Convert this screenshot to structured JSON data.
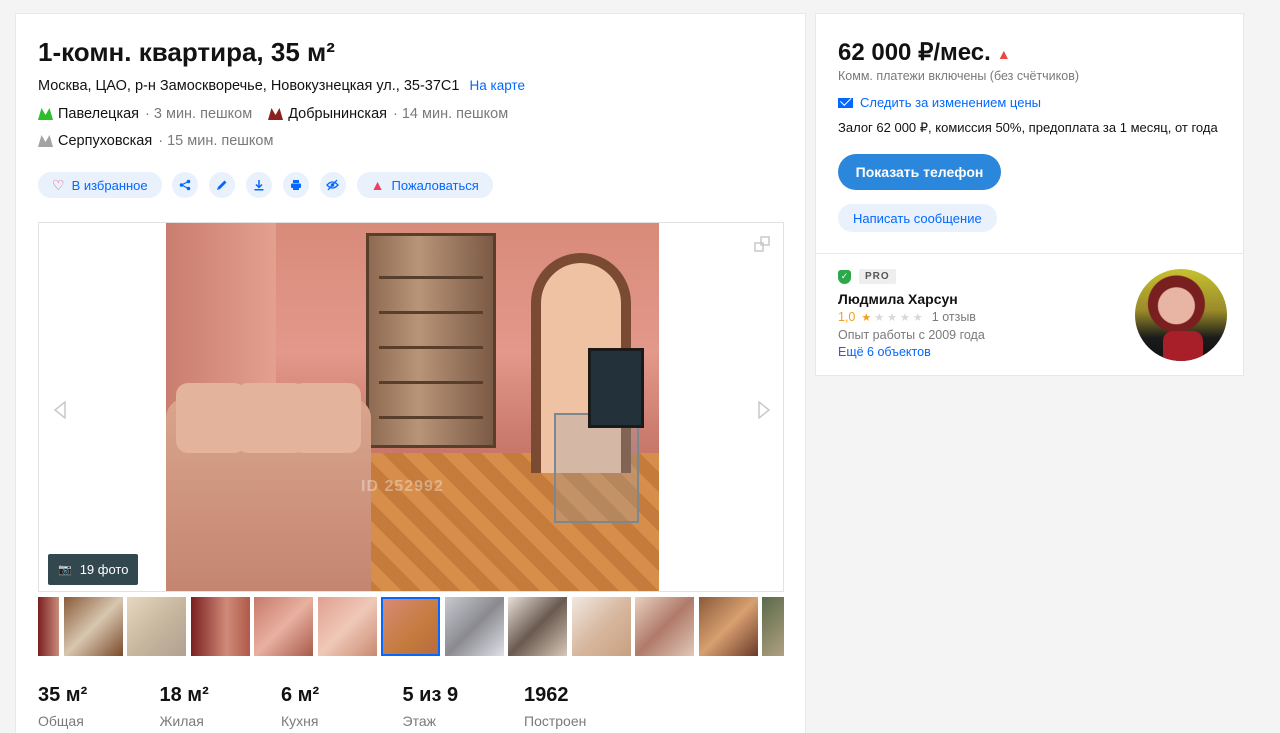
{
  "listing": {
    "title": "1-комн. квартира, 35 м²",
    "address": "Москва, ЦАО, р-н Замоскворечье, Новокузнецкая ул., 35-37С1",
    "map_link": "На карте",
    "metro": [
      {
        "station": "Павелецкая",
        "distance": "· 3 мин. пешком",
        "color": "#2dbe2c"
      },
      {
        "station": "Добрынинская",
        "distance": "· 14 мин. пешком",
        "color": "#8d5b2d"
      },
      {
        "station": "Серпуховская",
        "distance": "· 15 мин. пешком",
        "color": "#a3a3a3"
      }
    ]
  },
  "actions": {
    "favorite": "В избранное",
    "report": "Пожаловаться",
    "icons": [
      "share-icon",
      "edit-icon",
      "download-icon",
      "print-icon",
      "hide-icon"
    ]
  },
  "gallery": {
    "photo_count": "19 фото",
    "watermark": "ID 252992",
    "thumbnails": 12,
    "active_thumbnail": 6
  },
  "stats": [
    {
      "value": "35 м²",
      "label": "Общая"
    },
    {
      "value": "18 м²",
      "label": "Жилая"
    },
    {
      "value": "6 м²",
      "label": "Кухня"
    },
    {
      "value": "5 из 9",
      "label": "Этаж"
    },
    {
      "value": "1962",
      "label": "Построен"
    }
  ],
  "offer": {
    "price": "62 000 ₽/мес.",
    "utilities": "Комм. платежи включены (без счётчиков)",
    "follow_price": "Следить за изменением цены",
    "terms": "Залог 62 000 ₽, комиссия 50%, предоплата за 1 месяц, от года",
    "show_phone": "Показать телефон",
    "write_message": "Написать сообщение"
  },
  "agent": {
    "badge": "PRO",
    "name": "Людмила Харсун",
    "rating": "1,0",
    "rating_stars": 1,
    "reviews": "1 отзыв",
    "experience": "Опыт работы с 2009 года",
    "more_objects": "Ещё 6 объектов"
  },
  "colors": {
    "accent": "#0468ff",
    "primary_button": "#2b87db",
    "price_up": "#f0443f",
    "verified": "#2aa84a",
    "rating": "#f0a020"
  }
}
